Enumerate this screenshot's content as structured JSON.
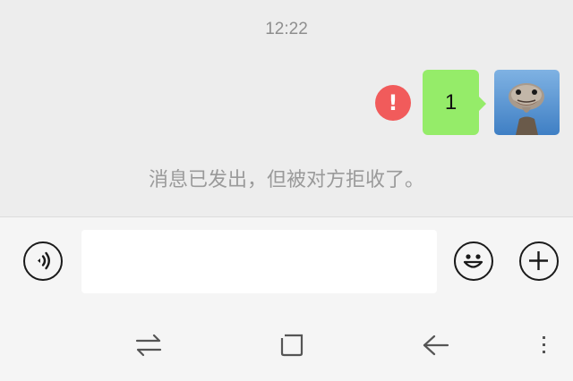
{
  "chat": {
    "timestamp": "12:22",
    "message": {
      "text": "1",
      "status": "failed",
      "status_icon": "error-exclamation-icon",
      "error_glyph": "!",
      "bubble_color": "#95ec69",
      "error_color": "#f15b5b"
    },
    "avatar": "ostrich-avatar-image",
    "system_notice": "消息已发出，但被对方拒收了。"
  },
  "input_bar": {
    "voice_icon": "voice-icon",
    "input_value": "",
    "input_placeholder": "",
    "emoji_icon": "emoji-icon",
    "plus_icon": "plus-icon"
  },
  "nav_bar": {
    "recent_icon": "recent-apps-icon",
    "home_icon": "home-icon",
    "back_icon": "back-icon",
    "menu_icon": "menu-icon"
  }
}
